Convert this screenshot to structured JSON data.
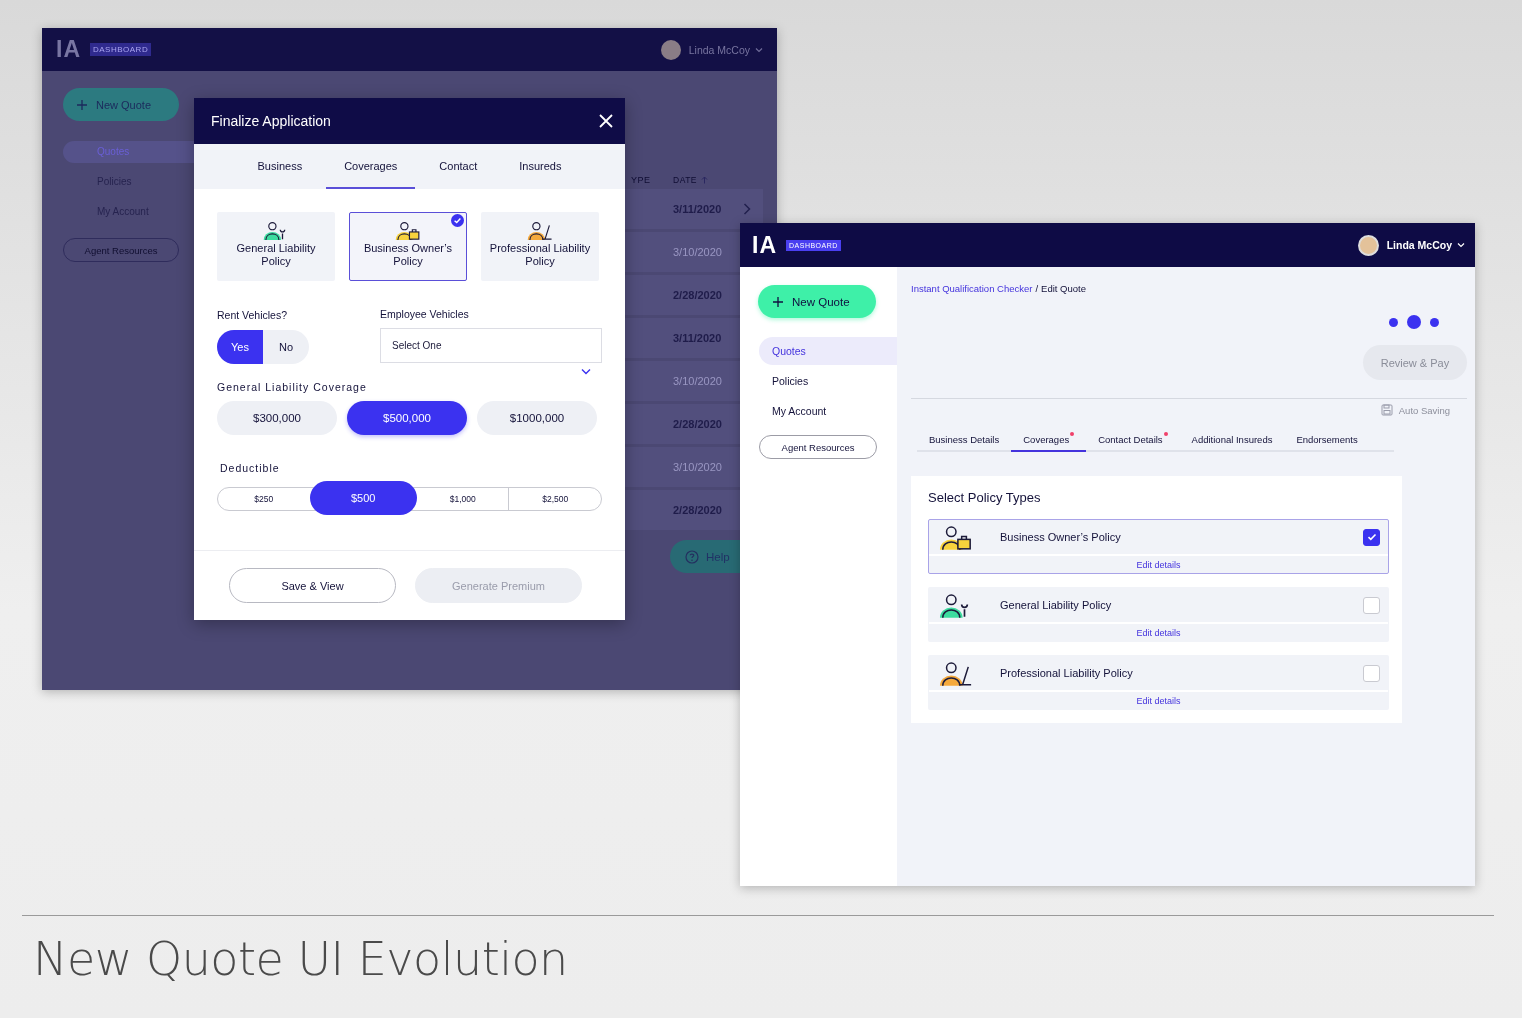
{
  "old_design": {
    "header": {
      "logo": "IA",
      "badge": "DASHBOARD",
      "user": "Linda McCoy"
    },
    "sidebar": {
      "new_button": "New Quote",
      "items": [
        {
          "label": "Quotes",
          "selected": true
        },
        {
          "label": "Policies",
          "selected": false
        },
        {
          "label": "My Account",
          "selected": false
        }
      ],
      "resources_button": "Agent Resources"
    },
    "table": {
      "columns": [
        "YPE",
        "DATE"
      ],
      "rows": [
        {
          "date": "3/11/2020",
          "muted": false
        },
        {
          "date": "3/10/2020",
          "muted": true
        },
        {
          "date": "2/28/2020",
          "muted": false
        },
        {
          "date": "3/11/2020",
          "muted": false
        },
        {
          "date": "3/10/2020",
          "muted": true
        },
        {
          "date": "2/28/2020",
          "muted": false
        },
        {
          "date": "3/10/2020",
          "muted": true
        },
        {
          "date": "2/28/2020",
          "muted": false
        }
      ]
    },
    "help_button": "Help",
    "modal": {
      "title": "Finalize Application",
      "tabs": [
        {
          "label": "Business",
          "selected": false
        },
        {
          "label": "Coverages",
          "selected": true
        },
        {
          "label": "Contact",
          "selected": false
        },
        {
          "label": "Insureds",
          "selected": false
        }
      ],
      "policies": [
        {
          "label": "General Liability Policy",
          "selected": false,
          "color": "#3ddc9f"
        },
        {
          "label": "Business Owner’s Policy",
          "selected": true,
          "color": "#f7d23c"
        },
        {
          "label": "Professional Liability Policy",
          "selected": false,
          "color": "#f5a93c"
        }
      ],
      "rent_vehicles": {
        "label": "Rent Vehicles?",
        "options": [
          {
            "label": "Yes",
            "selected": true
          },
          {
            "label": "No",
            "selected": false
          }
        ]
      },
      "employee_vehicles": {
        "label": "Employee Vehicles",
        "placeholder": "Select One"
      },
      "coverage": {
        "label": "General Liability Coverage",
        "options": [
          {
            "label": "$300,000",
            "selected": false
          },
          {
            "label": "$500,000",
            "selected": true
          },
          {
            "label": "$1000,000",
            "selected": false
          }
        ]
      },
      "deductible": {
        "label": "Deductible",
        "options": [
          {
            "label": "$250",
            "selected": false
          },
          {
            "label": "$500",
            "selected": true
          },
          {
            "label": "$1,000",
            "selected": false
          },
          {
            "label": "$2,500",
            "selected": false
          }
        ]
      },
      "buttons": [
        {
          "label": "Save & View",
          "disabled": false
        },
        {
          "label": "Generate Premium",
          "disabled": true
        }
      ]
    }
  },
  "new_design": {
    "header": {
      "logo": "IA",
      "badge": "DASHBOARD",
      "user": "Linda McCoy"
    },
    "sidebar": {
      "new_button": "New Quote",
      "items": [
        {
          "label": "Quotes",
          "selected": true
        },
        {
          "label": "Policies",
          "selected": false
        },
        {
          "label": "My Account",
          "selected": false
        }
      ],
      "resources_button": "Agent Resources"
    },
    "breadcrumb": {
      "link": "Instant Qualification Checker",
      "separator": "/",
      "current": "Edit Quote"
    },
    "steps": [
      {
        "selected": false
      },
      {
        "selected": true
      },
      {
        "selected": false
      }
    ],
    "review_button": {
      "label": "Review & Pay",
      "disabled": true
    },
    "save_status": "Auto Saving",
    "tabs": [
      {
        "label": "Business Details",
        "selected": false,
        "flagged": false
      },
      {
        "label": "Coverages",
        "selected": true,
        "flagged": true
      },
      {
        "label": "Contact Details",
        "selected": false,
        "flagged": true
      },
      {
        "label": "Additional Insureds",
        "selected": false,
        "flagged": false
      },
      {
        "label": "Endorsements",
        "selected": false,
        "flagged": false
      }
    ],
    "policy_panel": {
      "title": "Select Policy Types",
      "items": [
        {
          "name": "Business Owner’s Policy",
          "checked": true,
          "color": "#f7d23c",
          "link": "Edit details"
        },
        {
          "name": "General Liability Policy",
          "checked": false,
          "color": "#3ddc9f",
          "link": "Edit details"
        },
        {
          "name": "Professional Liability Policy",
          "checked": false,
          "color": "#f5a93c",
          "link": "Edit details"
        }
      ]
    }
  },
  "caption": "New Quote UI Evolution"
}
